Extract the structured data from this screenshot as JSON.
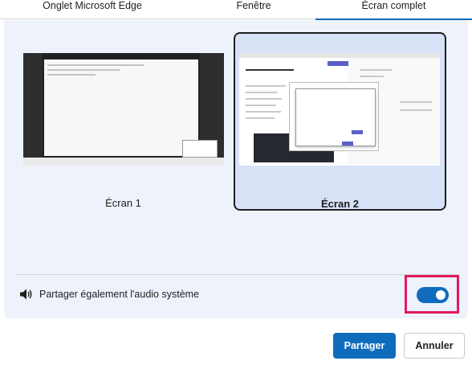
{
  "tabs": [
    {
      "label": "Onglet Microsoft Edge"
    },
    {
      "label": "Fenêtre"
    },
    {
      "label": "Écran complet",
      "active": true
    }
  ],
  "screens": [
    {
      "label": "Écran 1",
      "selected": false
    },
    {
      "label": "Écran 2",
      "selected": true
    }
  ],
  "audio": {
    "label": "Partager également l'audio système",
    "icon": "speaker-icon",
    "enabled": true
  },
  "buttons": {
    "share": "Partager",
    "cancel": "Annuler"
  },
  "colors": {
    "accent": "#0f6cbd",
    "highlight": "#e2195b",
    "panel": "#eef2fb",
    "selected_card": "#d7e2f7"
  }
}
